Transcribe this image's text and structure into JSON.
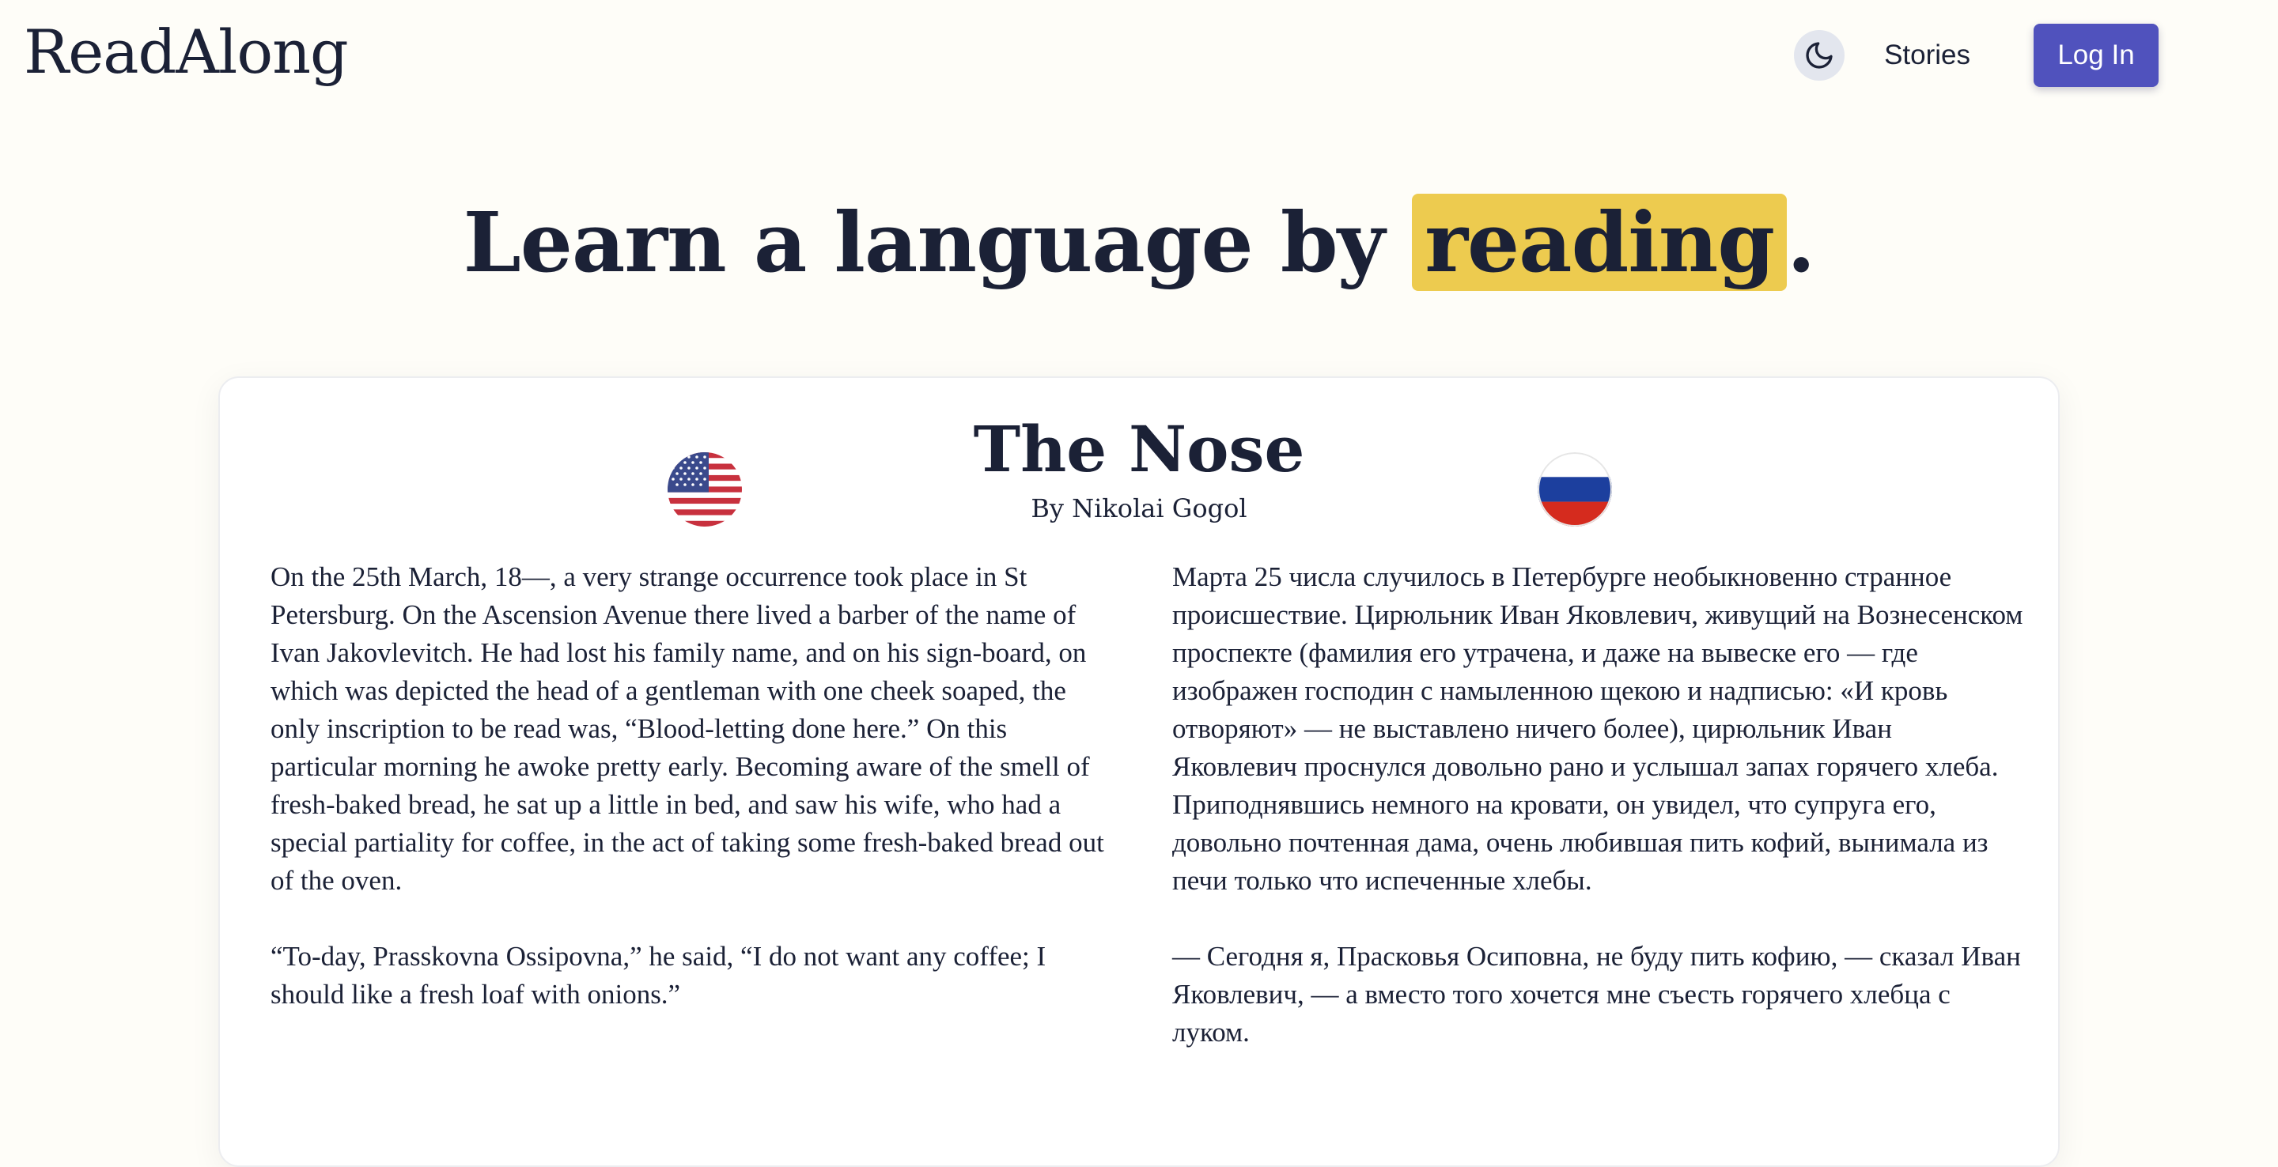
{
  "header": {
    "brand": "ReadAlong",
    "nav": {
      "stories_label": "Stories",
      "login_label": "Log In"
    }
  },
  "hero": {
    "prefix": "Learn a language by ",
    "highlight": "reading",
    "suffix": "."
  },
  "story": {
    "title": "The Nose",
    "author": "By Nikolai Gogol",
    "english": {
      "flag_icon": "us-flag-icon",
      "paragraphs": [
        "On the 25th March, 18—, a very strange occurrence took place in St Petersburg. On the Ascension Avenue there lived a barber of the name of Ivan Jakovlevitch. He had lost his family name, and on his sign-board, on which was depicted the head of a gentleman with one cheek soaped, the only inscription to be read was, “Blood-letting done here.” On this particular morning he awoke pretty early. Becoming aware of the smell of fresh-baked bread, he sat up a little in bed, and saw his wife, who had a special partiality for coffee, in the act of taking some fresh-baked bread out of the oven.",
        "“To-day, Prasskovna Ossipovna,” he said, “I do not want any coffee; I should like a fresh loaf with onions.”"
      ]
    },
    "russian": {
      "flag_icon": "russia-flag-icon",
      "paragraphs": [
        "Марта 25 числа случилось в Петербурге необыкновенно странное происшествие. Цирюльник Иван Яковлевич, живущий на Вознесенском проспекте (фамилия его утрачена, и даже на вывеске его — где изображен господин с намыленною щекою и надписью: «И кровь отворяют» — не выставлено ничего более), цирюльник Иван Яковлевич проснулся довольно рано и услышал запах горячего хлеба. Приподнявшись немного на кровати, он увидел, что супруга его, довольно почтенная дама, очень любившая пить кофий, вынимала из печи только что испеченные хлебы.",
        "— Сегодня я, Прасковья Осиповна, не буду пить кофию, — сказал Иван Яковлевич, — а вместо того хочется мне съесть горячего хлебца с луком."
      ]
    }
  },
  "colors": {
    "background": "#fefdf8",
    "text": "#1b2136",
    "accent": "#5052bd",
    "highlight": "#edcb4f"
  },
  "icons": {
    "theme_toggle": "moon-icon"
  }
}
